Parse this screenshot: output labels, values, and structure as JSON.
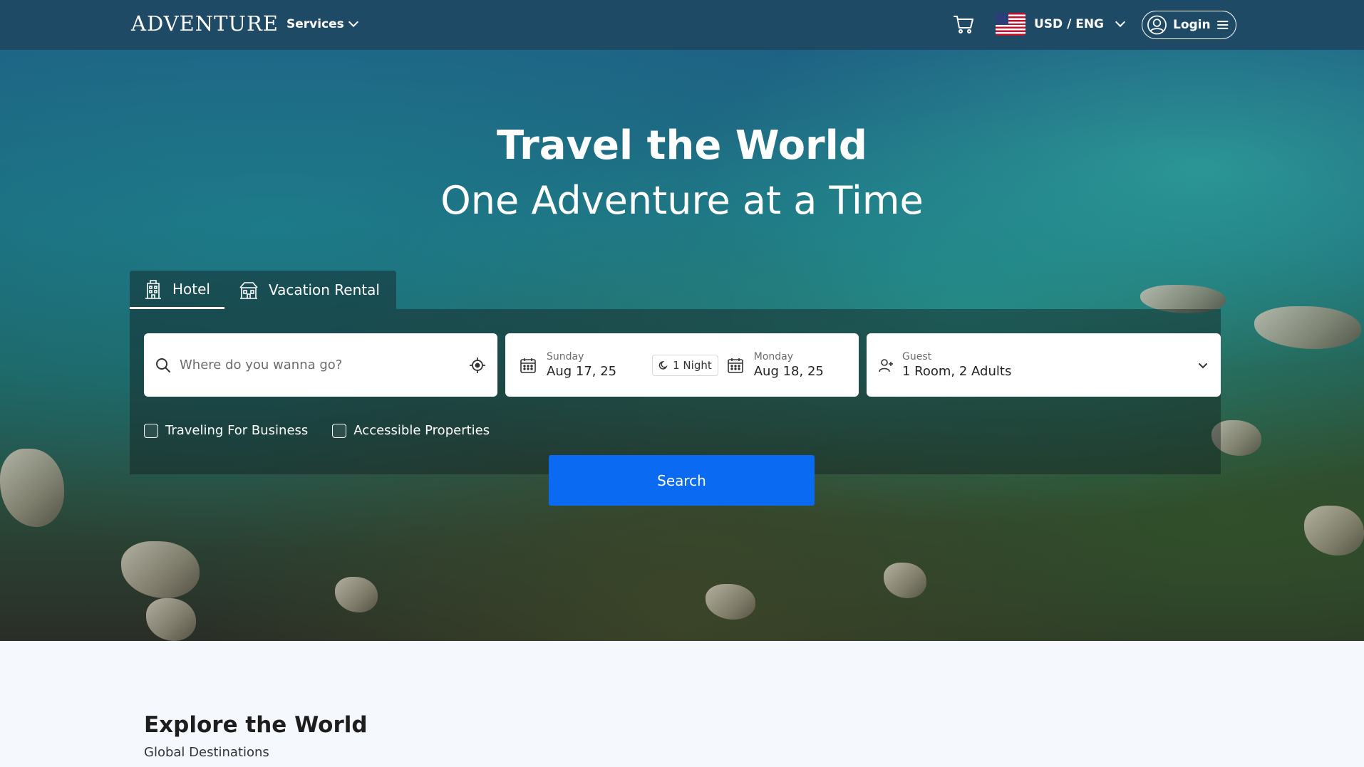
{
  "header": {
    "brand": "ADVENTURE",
    "services_label": "Services",
    "currency_label": "USD / ENG",
    "login_label": "Login"
  },
  "hero": {
    "title": "Travel the World",
    "subtitle": "One Adventure at a Time"
  },
  "search": {
    "tabs": [
      {
        "label": "Hotel",
        "icon": "hotel-icon",
        "active": true
      },
      {
        "label": "Vacation Rental",
        "icon": "vacation-rental-icon",
        "active": false
      }
    ],
    "destination": {
      "placeholder": "Where do you wanna go?",
      "value": ""
    },
    "checkin": {
      "day": "Sunday",
      "date": "Aug 17, 25"
    },
    "nights": "1 Night",
    "checkout": {
      "day": "Monday",
      "date": "Aug 18, 25"
    },
    "guest": {
      "label": "Guest",
      "value": "1 Room, 2 Adults"
    },
    "checkboxes": {
      "business": "Traveling For Business",
      "accessible": "Accessible Properties"
    },
    "search_button": "Search"
  },
  "explore": {
    "title": "Explore the World",
    "subtitle": "Global Destinations"
  },
  "colors": {
    "navbar": "#1f4a66",
    "search_button": "#0a6bf2"
  }
}
